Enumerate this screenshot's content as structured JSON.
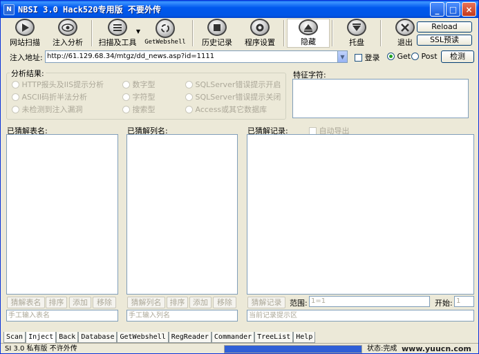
{
  "window": {
    "title": "NBSI 3.0 Hack520专用版  不要外传"
  },
  "toolbar": {
    "tools": [
      {
        "label": "网站扫描",
        "icon": "play-icon"
      },
      {
        "label": "注入分析",
        "icon": "eye-icon"
      },
      {
        "label": "扫描及工具",
        "icon": "list-icon"
      },
      {
        "label": "GetWebshell",
        "icon": "recycle-icon"
      },
      {
        "label": "历史记录",
        "icon": "stop-icon"
      },
      {
        "label": "程序设置",
        "icon": "settings-icon"
      },
      {
        "label": "隐藏",
        "icon": "up-arrow-icon"
      },
      {
        "label": "托盘",
        "icon": "down-arrow-icon"
      },
      {
        "label": "退出",
        "icon": "close-x-icon"
      }
    ],
    "reload": "Reload",
    "ssl": "SSL预读"
  },
  "url": {
    "label": "注入地址:",
    "value": "http://61.129.68.34/mtgz/dd_news.asp?id=1111",
    "login": "登录",
    "get": "Get",
    "post": "Post",
    "detect": "检测"
  },
  "analysis": {
    "title": "分析结果:",
    "col1": [
      "HTTP报头及IIS提示分析",
      "ASCII码折半法分析",
      "未检测到注入漏洞"
    ],
    "col2": [
      "数字型",
      "字符型",
      "搜索型"
    ],
    "col3": [
      "SQLServer错误提示开启",
      "SQLServer错误提示关闭",
      "Access或其它数据库"
    ]
  },
  "feature": {
    "title": "特征字符:"
  },
  "tables": {
    "title": "已猜解表名:",
    "buttons": [
      "猜解表名",
      "排序",
      "添加",
      "移除"
    ],
    "placeholder": "手工输入表名"
  },
  "columns": {
    "title": "已猜解列名:",
    "buttons": [
      "猜解列名",
      "排序",
      "添加",
      "移除"
    ],
    "placeholder": "手工输入列名"
  },
  "records": {
    "title": "已猜解记录:",
    "auto_export": "自动导出",
    "guess_button": "猜解记录",
    "range_label": "范围:",
    "range_value": "1=1",
    "start_label": "开始:",
    "start_value": "1",
    "hint": "当前记录提示区"
  },
  "tabs": [
    "Scan",
    "Inject",
    "Back",
    "Database",
    "GetWebshell",
    "RegReader",
    "Commander",
    "TreeList",
    "Help"
  ],
  "status": {
    "left": "SI 3.0 私有版 不许外传",
    "right": "状态:完成",
    "watermark": "www.yuucn.com",
    "progress": 1.0
  },
  "colors": {
    "titlebar": "#0055E5",
    "face": "#ECE9D8",
    "progress": "#2F5FD6"
  }
}
